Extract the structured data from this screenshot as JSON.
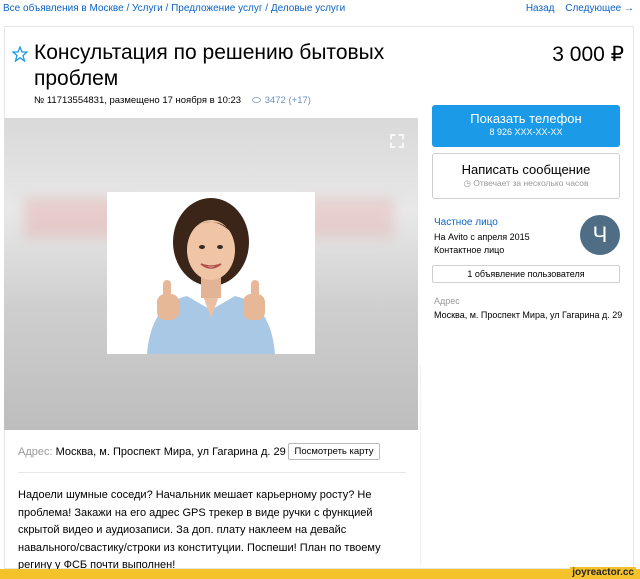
{
  "breadcrumbs": [
    "Все объявления в Москве",
    "Услуги",
    "Предложение услуг",
    "Деловые услуги"
  ],
  "nav": {
    "back": "Назад",
    "next": "Следующее →"
  },
  "listing": {
    "title": "Консультация по решению бытовых проблем",
    "price": "3 000 ₽",
    "meta": "№ 11713554831, размещено 17 ноября в 10:23",
    "views": "3472 (+17)"
  },
  "address": {
    "label": "Адрес:",
    "value": "Москва, м. Проспект Мира, ул Гагарина д. 29",
    "map_button": "Посмотреть карту"
  },
  "description": "Надоели шумные соседи? Начальник мешает карьерному росту? Не проблема! Закажи на его адрес GPS трекер в виде ручки с функцией скрытой видео и аудиозаписи. За доп. плату наклеем на девайс навального/свастику/строки из конституции. Поспеши! План по твоему регину у ФСБ почти выполнен!",
  "sidebar": {
    "phone_button": "Показать телефон",
    "phone_number": "8 926 XXX-XX-XX",
    "message_button": "Написать сообщение",
    "message_hint": "Отвечает за несколько часов",
    "seller_type": "Частное лицо",
    "since": "На Avito с апреля 2015",
    "contact": "Контактное лицо",
    "avatar_letter": "Ч",
    "ads_button": "1 объявление пользователя",
    "address_label": "Адрес",
    "address_value": "Москва, м. Проспект Мира, ул Гагарина д. 29"
  },
  "watermark": "joyreactor.cc",
  "colors": {
    "link": "#0b63c4",
    "primary": "#1a9ae7",
    "avatar": "#4f6d85",
    "footer": "#f6c22c"
  }
}
